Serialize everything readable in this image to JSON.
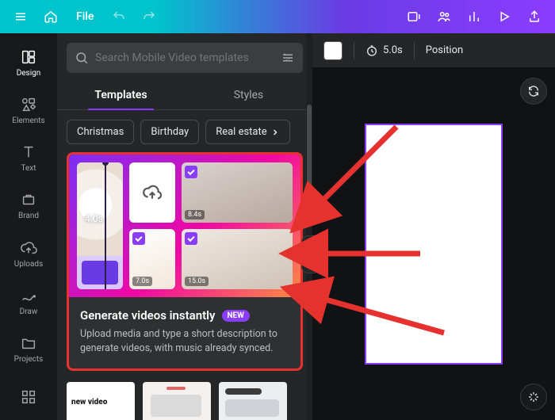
{
  "topbar": {
    "file_label": "File"
  },
  "rail": {
    "design": "Design",
    "elements": "Elements",
    "text": "Text",
    "brand": "Brand",
    "uploads": "Uploads",
    "draw": "Draw",
    "projects": "Projects"
  },
  "search": {
    "placeholder": "Search Mobile Video templates"
  },
  "tabs": {
    "templates": "Templates",
    "styles": "Styles"
  },
  "chips": {
    "christmas": "Christmas",
    "birthday": "Birthday",
    "realestate": "Real estate"
  },
  "feature_card": {
    "tile2_dur": "8.4s",
    "tile3_dur": "7.0s",
    "tile4_dur": "15.0s",
    "big_dur": "4.0s",
    "title": "Generate videos instantly",
    "badge": "NEW",
    "desc": "Upload media and type a short description to generate videos, with music already synced."
  },
  "thumbs": {
    "t1_text": "new video"
  },
  "canvas_toolbar": {
    "duration": "5.0s",
    "position": "Position"
  }
}
